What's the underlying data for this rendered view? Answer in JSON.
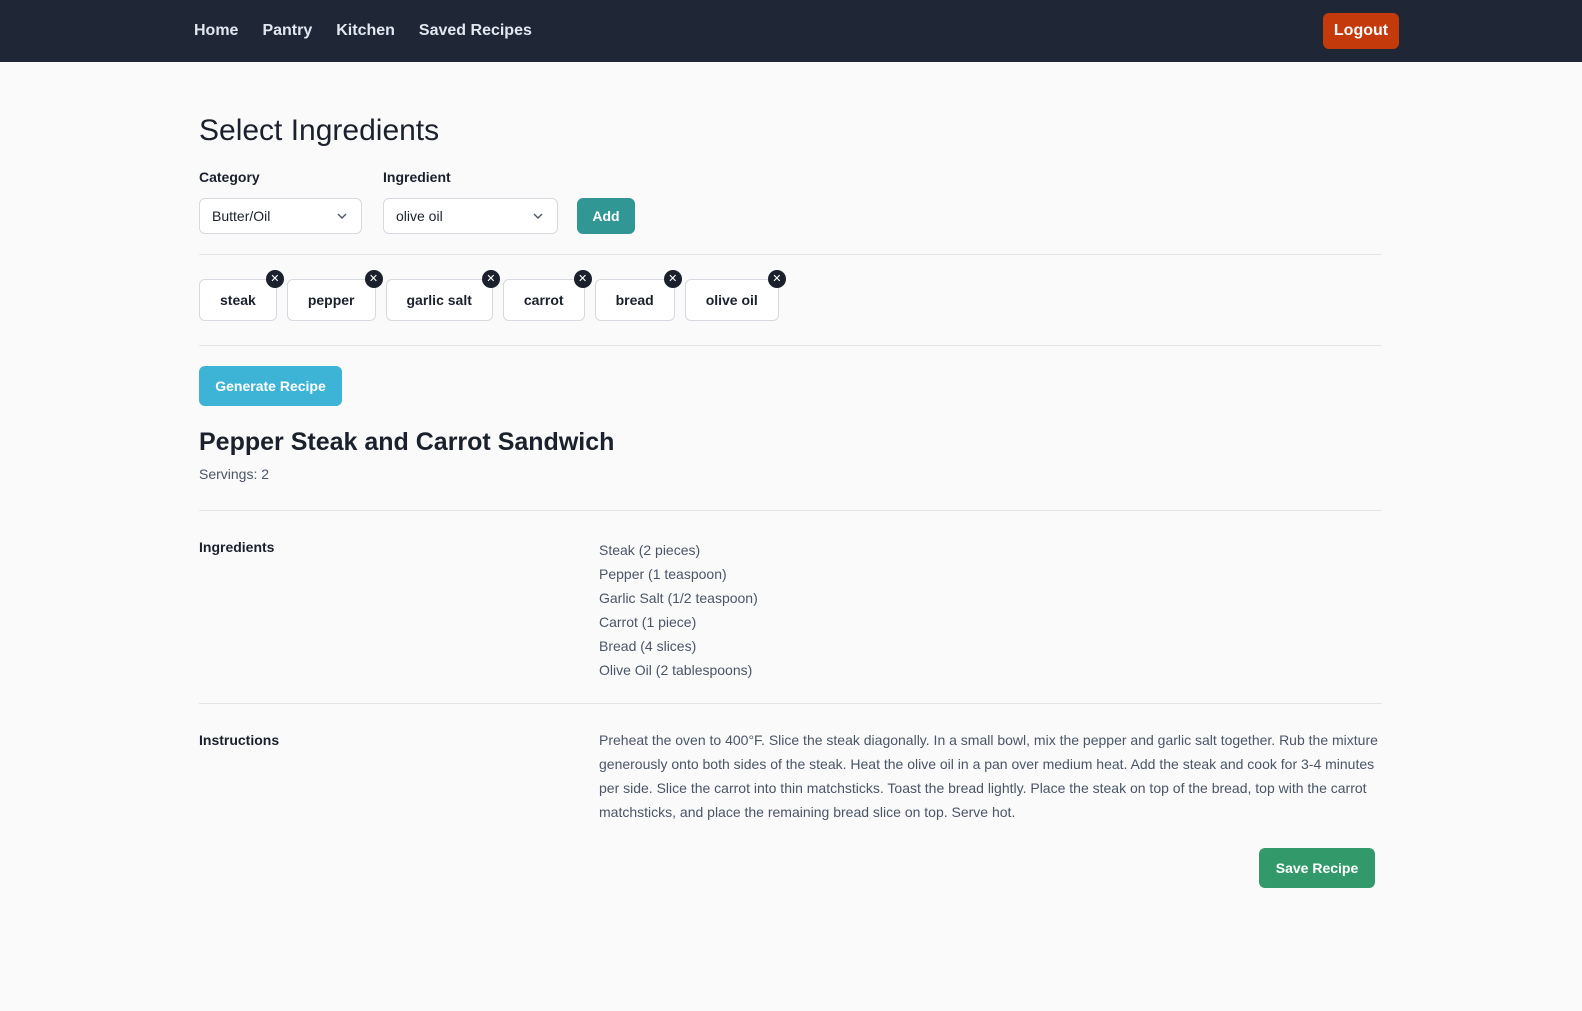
{
  "nav": {
    "links": [
      "Home",
      "Pantry",
      "Kitchen",
      "Saved Recipes"
    ],
    "logout_label": "Logout"
  },
  "selector": {
    "title": "Select Ingredients",
    "category_label": "Category",
    "category_value": "Butter/Oil",
    "ingredient_label": "Ingredient",
    "ingredient_value": "olive oil",
    "add_label": "Add"
  },
  "selected_ingredients": [
    "steak",
    "pepper",
    "garlic salt",
    "carrot",
    "bread",
    "olive oil"
  ],
  "chip_remove_glyph": "✕",
  "generate_label": "Generate Recipe",
  "recipe": {
    "title": "Pepper Steak and Carrot Sandwich",
    "servings": "Servings: 2",
    "ingredients_label": "Ingredients",
    "ingredients": [
      "Steak (2 pieces)",
      "Pepper (1 teaspoon)",
      "Garlic Salt (1/2 teaspoon)",
      "Carrot (1 piece)",
      "Bread (4 slices)",
      "Olive Oil (2 tablespoons)"
    ],
    "instructions_label": "Instructions",
    "instructions": "Preheat the oven to 400°F. Slice the steak diagonally. In a small bowl, mix the pepper and garlic salt together. Rub the mixture generously onto both sides of the steak. Heat the olive oil in a pan over medium heat. Add the steak and cook for 3-4 minutes per side. Slice the carrot into thin matchsticks. Toast the bread lightly. Place the steak on top of the bread, top with the carrot matchsticks, and place the remaining bread slice on top. Serve hot.",
    "save_label": "Save Recipe"
  }
}
